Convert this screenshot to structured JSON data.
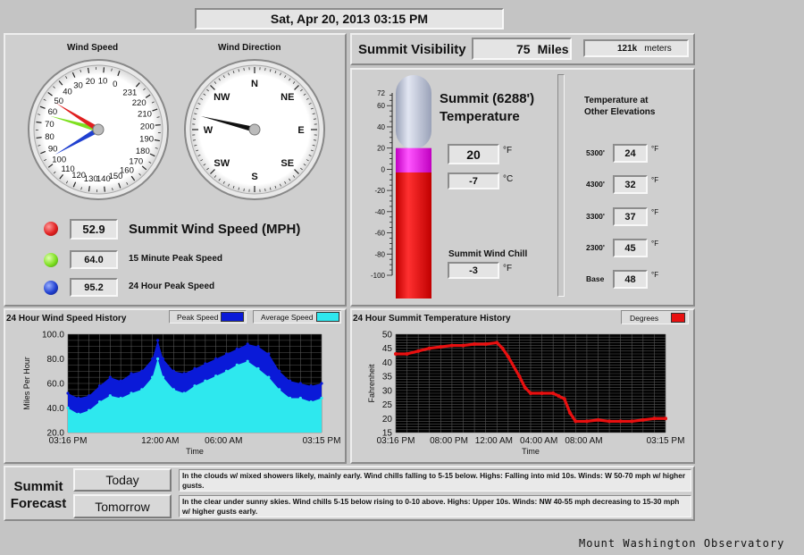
{
  "header": {
    "datetime": "Sat, Apr 20, 2013  03:15 PM"
  },
  "wind_speed_gauge": {
    "title": "Wind Speed",
    "ticks": [
      "0",
      "10",
      "20",
      "30",
      "40",
      "50",
      "60",
      "70",
      "80",
      "90",
      "100",
      "110",
      "120",
      "130",
      "140",
      "150",
      "160",
      "170",
      "180",
      "190",
      "200",
      "210",
      "220",
      "231"
    ],
    "needles": {
      "current": 52.9,
      "peak15": 64.0,
      "peak24": 95.2
    }
  },
  "wind_direction_gauge": {
    "title": "Wind Direction",
    "labels": [
      "N",
      "NE",
      "E",
      "SE",
      "S",
      "SW",
      "W",
      "NW"
    ],
    "direction_deg": 284
  },
  "wind_readouts": {
    "current_value": "52.9",
    "current_label": "Summit Wind Speed (MPH)",
    "peak15_value": "64.0",
    "peak15_label": "15 Minute Peak Speed",
    "peak24_value": "95.2",
    "peak24_label": "24 Hour Peak Speed",
    "colors": {
      "current": "#e02020",
      "peak15": "#7ee020",
      "peak24": "#2040d0"
    }
  },
  "visibility": {
    "label": "Summit Visibility",
    "value": "75",
    "unit": "Miles",
    "meters_value": "121k",
    "meters_unit": "meters"
  },
  "temperature": {
    "title_line1": "Summit (6288')",
    "title_line2": "Temperature",
    "value": "20",
    "unit_f": "°F",
    "celsius": "-7",
    "unit_c": "°C",
    "wind_chill_label": "Summit Wind Chill",
    "wind_chill_value": "-3",
    "wind_chill_unit": "°F",
    "scale_ticks": [
      "72",
      "60",
      "40",
      "20",
      "0",
      "-20",
      "-40",
      "-60",
      "-80",
      "-100"
    ],
    "scale_top": 72,
    "scale_bottom": -100,
    "fill_red_value": -3,
    "fill_magenta_value": 20
  },
  "elevations": {
    "title_line1": "Temperature at",
    "title_line2": "Other Elevations",
    "rows": [
      {
        "label": "5300'",
        "value": "24",
        "unit": "°F"
      },
      {
        "label": "4300'",
        "value": "32",
        "unit": "°F"
      },
      {
        "label": "3300'",
        "value": "37",
        "unit": "°F"
      },
      {
        "label": "2300'",
        "value": "45",
        "unit": "°F"
      },
      {
        "label": "Base",
        "value": "48",
        "unit": "°F"
      }
    ]
  },
  "wind_history": {
    "title": "24 Hour Wind Speed History",
    "legend_peak": "Peak Speed",
    "legend_avg": "Average Speed",
    "colors": {
      "peak": "#0a1ad8",
      "avg": "#2ee8ee"
    }
  },
  "temp_history": {
    "title": "24 Hour Summit Temperature History",
    "legend": "Degrees",
    "colors": {
      "line": "#e81010"
    }
  },
  "chart_data": [
    {
      "type": "area",
      "title": "24 Hour Wind Speed History",
      "xlabel": "Time",
      "ylabel": "Miles Per Hour",
      "ylim": [
        20,
        100
      ],
      "y_ticks": [
        "100.0",
        "80.0",
        "60.0",
        "40.0",
        "20.0"
      ],
      "x_ticks": [
        "03:16 PM",
        "12:00 AM",
        "06:00 AM",
        "03:15 PM"
      ],
      "x_tick_hours": [
        0,
        8.73,
        14.73,
        24
      ],
      "grid": true,
      "x_hours": [
        0,
        1,
        2,
        3,
        4,
        5,
        6,
        7,
        8,
        8.5,
        9,
        10,
        11,
        12,
        13,
        14,
        15,
        16,
        17,
        18,
        19,
        20,
        21,
        22,
        23,
        24
      ],
      "series": [
        {
          "name": "Peak Speed",
          "values": [
            52,
            48,
            50,
            58,
            65,
            62,
            68,
            70,
            80,
            95,
            80,
            70,
            68,
            72,
            76,
            80,
            84,
            88,
            92,
            90,
            84,
            70,
            62,
            60,
            58,
            60
          ]
        },
        {
          "name": "Average Speed",
          "values": [
            40,
            35,
            38,
            45,
            50,
            48,
            52,
            55,
            65,
            80,
            65,
            55,
            52,
            58,
            62,
            66,
            70,
            75,
            78,
            72,
            65,
            55,
            48,
            48,
            45,
            48
          ]
        }
      ]
    },
    {
      "type": "line",
      "title": "24 Hour Summit Temperature History",
      "xlabel": "Time",
      "ylabel": "Fahrenheit",
      "ylim": [
        15,
        50
      ],
      "y_ticks": [
        "50",
        "45",
        "40",
        "35",
        "30",
        "25",
        "20",
        "15"
      ],
      "x_ticks": [
        "03:16 PM",
        "08:00 PM",
        "12:00 AM",
        "04:00 AM",
        "08:00 AM",
        "03:15 PM"
      ],
      "x_tick_hours": [
        0,
        4.73,
        8.73,
        12.73,
        16.73,
        24
      ],
      "grid": true,
      "x_hours": [
        0,
        1,
        2,
        3,
        4,
        5,
        6,
        7,
        8,
        9,
        9.5,
        10,
        11,
        11.5,
        12,
        13,
        14,
        14.5,
        15,
        15.5,
        16,
        17,
        18,
        19,
        20,
        21,
        22,
        23,
        24
      ],
      "series": [
        {
          "name": "Degrees",
          "values": [
            43,
            43,
            44,
            45,
            45.5,
            46,
            46,
            46.5,
            46.5,
            47,
            45,
            42,
            35,
            31,
            29,
            29,
            29,
            28,
            27,
            22,
            19,
            19,
            19.5,
            19,
            19,
            19,
            19.5,
            20,
            20
          ]
        }
      ]
    }
  ],
  "forecast": {
    "title_line1": "Summit",
    "title_line2": "Forecast",
    "today_label": "Today",
    "tomorrow_label": "Tomorrow",
    "today_text": "In the clouds w/ mixed showers likely, mainly early. Wind chills falling to 5-15 below.  Highs: Falling into mid 10s.  Winds: W 50-70 mph w/ higher gusts.",
    "tomorrow_text": "In the clear under sunny skies. Wind chills 5-15 below rising to 0-10 above.  Highs: Upper 10s.  Winds: NW 40-55 mph decreasing to 15-30 mph w/ higher gusts early."
  },
  "footer": {
    "credit": "Mount Washington Observatory"
  }
}
